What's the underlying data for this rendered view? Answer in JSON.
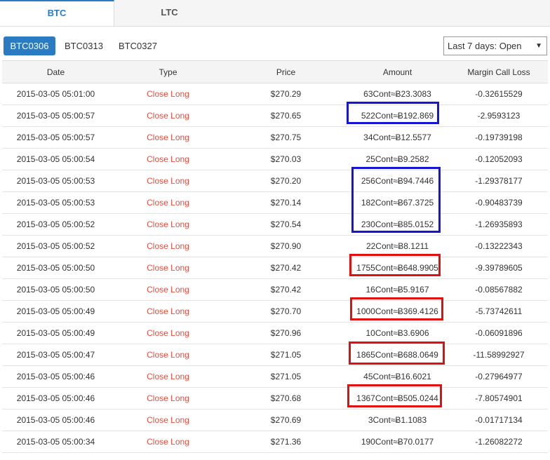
{
  "tabs": {
    "btc": "BTC",
    "ltc": "LTC"
  },
  "contracts": [
    "BTC0306",
    "BTC0313",
    "BTC0327"
  ],
  "filter": {
    "selected": "Last 7 days: Open"
  },
  "table": {
    "headers": [
      "Date",
      "Type",
      "Price",
      "Amount",
      "Margin Call Loss"
    ],
    "rows": [
      [
        "2015-03-05 05:01:00",
        "Close Long",
        "$270.29",
        "63Cont≈Ƀ23.3083",
        "-0.32615529"
      ],
      [
        "2015-03-05 05:00:57",
        "Close Long",
        "$270.65",
        "522Cont≈Ƀ192.869",
        "-2.9593123"
      ],
      [
        "2015-03-05 05:00:57",
        "Close Long",
        "$270.75",
        "34Cont≈Ƀ12.5577",
        "-0.19739198"
      ],
      [
        "2015-03-05 05:00:54",
        "Close Long",
        "$270.03",
        "25Cont≈Ƀ9.2582",
        "-0.12052093"
      ],
      [
        "2015-03-05 05:00:53",
        "Close Long",
        "$270.20",
        "256Cont≈Ƀ94.7446",
        "-1.29378177"
      ],
      [
        "2015-03-05 05:00:53",
        "Close Long",
        "$270.14",
        "182Cont≈Ƀ67.3725",
        "-0.90483739"
      ],
      [
        "2015-03-05 05:00:52",
        "Close Long",
        "$270.54",
        "230Cont≈Ƀ85.0152",
        "-1.26935893"
      ],
      [
        "2015-03-05 05:00:52",
        "Close Long",
        "$270.90",
        "22Cont≈Ƀ8.1211",
        "-0.13222343"
      ],
      [
        "2015-03-05 05:00:50",
        "Close Long",
        "$270.42",
        "1755Cont≈Ƀ648.9905",
        "-9.39789605"
      ],
      [
        "2015-03-05 05:00:50",
        "Close Long",
        "$270.42",
        "16Cont≈Ƀ5.9167",
        "-0.08567882"
      ],
      [
        "2015-03-05 05:00:49",
        "Close Long",
        "$270.70",
        "1000Cont≈Ƀ369.4126",
        "-5.73742611"
      ],
      [
        "2015-03-05 05:00:49",
        "Close Long",
        "$270.96",
        "10Cont≈Ƀ3.6906",
        "-0.06091896"
      ],
      [
        "2015-03-05 05:00:47",
        "Close Long",
        "$271.05",
        "1865Cont≈Ƀ688.0649",
        "-11.58992927"
      ],
      [
        "2015-03-05 05:00:46",
        "Close Long",
        "$271.05",
        "45Cont≈Ƀ16.6021",
        "-0.27964977"
      ],
      [
        "2015-03-05 05:00:46",
        "Close Long",
        "$270.68",
        "1367Cont≈Ƀ505.0244",
        "-7.80574901"
      ],
      [
        "2015-03-05 05:00:46",
        "Close Long",
        "$270.69",
        "3Cont≈Ƀ1.1083",
        "-0.01717134"
      ],
      [
        "2015-03-05 05:00:34",
        "Close Long",
        "$271.36",
        "190Cont≈Ƀ70.0177",
        "-1.26082272"
      ]
    ]
  },
  "colors": {
    "accent": "#2a7bc1",
    "type_text": "#e74c3c",
    "highlight_blue": "#1515d6",
    "highlight_red": "#e01010"
  }
}
